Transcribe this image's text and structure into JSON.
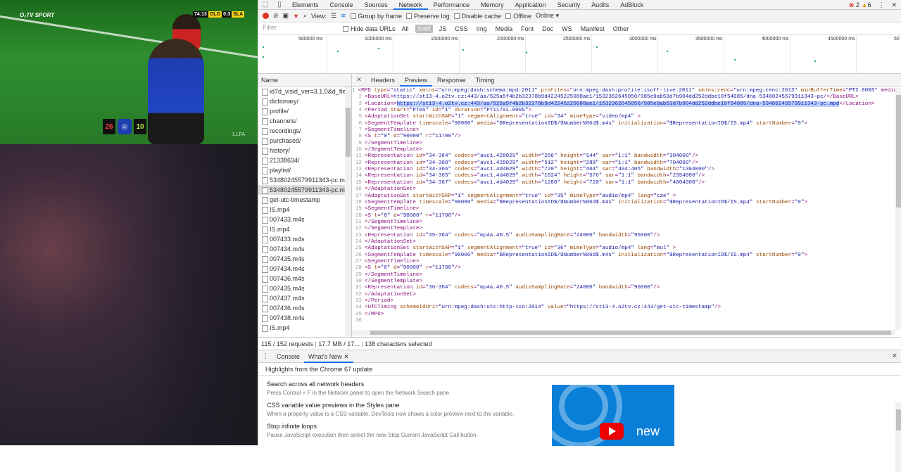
{
  "video": {
    "logo": "O₂TV SPORT",
    "score": {
      "time": "74:13",
      "home": "OLO",
      "result": "0:3",
      "away": "SLA"
    },
    "badge_left": "26",
    "badge_right": "10",
    "watermark": "1.LFA"
  },
  "devtools": {
    "tabs": [
      "Elements",
      "Console",
      "Sources",
      "Network",
      "Performance",
      "Memory",
      "Application",
      "Security",
      "Audits",
      "AdBlock"
    ],
    "errors": "2",
    "warnings": "6",
    "toolbar": {
      "view_label": "View:",
      "group_by_frame": "Group by frame",
      "preserve_log": "Preserve log",
      "disable_cache": "Disable cache",
      "offline": "Offline",
      "throttle": "Online"
    },
    "filter": {
      "placeholder": "Filter",
      "hide_data_urls": "Hide data URLs",
      "types": [
        "All",
        "XHR",
        "JS",
        "CSS",
        "Img",
        "Media",
        "Font",
        "Doc",
        "WS",
        "Manifest",
        "Other"
      ]
    },
    "overview_ticks": [
      "500000 ms",
      "1000000 ms",
      "1500000 ms",
      "2000000 ms",
      "2500000 ms",
      "3000000 ms",
      "3500000 ms",
      "4000000 ms",
      "4500000 ms",
      "50"
    ],
    "name_header": "Name",
    "requests": [
      "id7d_visid_ver=3.1.0&d_fieldgr",
      "dictionary/",
      "profile/",
      "channels/",
      "recordings/",
      "purchased/",
      "history/",
      "21338634/",
      "playlist/",
      "53480245579911343-pc.mpd",
      "53480245579911343-pc.mpd",
      "get-utc-timestamp",
      "IS.mp4",
      "007433.m4s",
      "IS.mp4",
      "007433.m4s",
      "007434.m4s",
      "007435.m4s",
      "007434.m4s",
      "007436.m4s",
      "007435.m4s",
      "007437.m4s",
      "007436.m4s",
      "007438.m4s",
      "IS.mp4"
    ],
    "status": {
      "requests": "115 / 152 requests",
      "transferred": "17.7 MB / 17...",
      "selection": "138 characters selected"
    },
    "detail_tabs": [
      "Headers",
      "Preview",
      "Response",
      "Timing"
    ],
    "code_lines": [
      "<MPD type=\"static\" xmlns=\"urn:mpeg:dash:schema:mpd:2011\" profiles=\"urn:mpeg:dash:profile:isoff-live:2011\" xmlns:cenc=\"urn:mpeg:cenc:2013\" minBufferTime=\"PT2.000S\" mediaP",
      "<BaseURL>https://st13-4.o2tv.cz:443/aa/525a5f4b2b32378b9d42245225088ae1/1532362645050/985e9ab53d7b904dd252ddbe10f54085/dna-53480245579911343-pc/</BaseURL>",
      "<Location>https://st13-4.o2tv.cz:443/aa/525a5f4b2b32378b9d42245225088ae1/1532362645050/985e9ab53d7b904dd252ddbe10f54085/dna-53480245579911343-pc.mpd</Location>",
      "<Period start=\"PT0S\" id=\"1\" duration=\"PT11701.000S\">",
      "<AdaptationSet startWithSAP=\"1\" segmentAlignment=\"true\" id=\"34\" mimeType=\"video/mp4\" >",
      "<SegmentTemplate timescale=\"90000\" media=\"$RepresentationID$/$Number%06d$.m4s\" initialization=\"$RepresentationID$/IS.mp4\" startNumber=\"0\">",
      "<SegmentTimeline>",
      "<S t=\"0\" d=\"90000\" r=\"11700\"/>",
      "</SegmentTimeline>",
      "</SegmentTemplate>",
      "<Representation id=\"34-364\" codecs=\"avc1.428029\" width=\"256\" height=\"144\" sar=\"1:1\" bandwidth=\"304000\"/>",
      "<Representation id=\"34-360\" codecs=\"avc1.428029\" width=\"512\" height=\"288\" sar=\"1:1\" bandwidth=\"704000\"/>",
      "<Representation id=\"34-366\" codecs=\"avc1.4d4029\" width=\"720\" height=\"404\" sar=\"404:405\" bandwidth=\"1304000\"/>",
      "<Representation id=\"34-365\" codecs=\"avc1.4d4029\" width=\"1024\" height=\"576\" sar=\"1:1\" bandwidth=\"2354000\"/>",
      "<Representation id=\"34-367\" codecs=\"avc1.4d4029\" width=\"1280\" height=\"720\" sar=\"1:1\" bandwidth=\"4004000\"/>",
      "</AdaptationSet>",
      "<AdaptationSet startWithSAP=\"1\" segmentAlignment=\"true\" id=\"35\" mimeType=\"audio/mp4\" lang=\"cze\" >",
      "<SegmentTemplate timescale=\"90000\" media=\"$RepresentationID$/$Number%06d$.m4s\" initialization=\"$RepresentationID$/IS.mp4\" startNumber=\"0\">",
      "<SegmentTimeline>",
      "<S t=\"0\" d=\"90000\" r=\"11700\"/>",
      "</SegmentTimeline>",
      "</SegmentTemplate>",
      "<Representation id=\"35-364\" codecs=\"mp4a.40.5\" audioSamplingRate=\"24000\" bandwidth=\"96000\"/>",
      "</AdaptationSet>",
      "<AdaptationSet startWithSAP=\"1\" segmentAlignment=\"true\" id=\"36\" mimeType=\"audio/mp4\" lang=\"mul\" >",
      "<SegmentTemplate timescale=\"90000\" media=\"$RepresentationID$/$Number%06d$.m4s\" initialization=\"$RepresentationID$/IS.mp4\" startNumber=\"0\">",
      "<SegmentTimeline>",
      "<S t=\"0\" d=\"90000\" r=\"11700\"/>",
      "</SegmentTimeline>",
      "</SegmentTemplate>",
      "<Representation id=\"36-364\" codecs=\"mp4a.40.5\" audioSamplingRate=\"24000\" bandwidth=\"96000\"/>",
      "</AdaptationSet>",
      "</Period>",
      "<UTCTiming schemeIdUri=\"urn:mpeg:dash:utc:http-iso:2014\" value=\"https://st13-4.o2tv.cz:443/get-utc-timestamp\"/>",
      "</MPD>",
      ""
    ],
    "drawer": {
      "tabs": [
        "Console",
        "What's New"
      ],
      "highlights": "Highlights from the Chrome 67 update",
      "items": [
        {
          "title": "Search across all network headers",
          "desc": "Press Control + F in the Network panel to open the Network Search pane."
        },
        {
          "title": "CSS variable value previews in the Styles pane",
          "desc": "When a property value is a CSS variable, DevTools now shows a color preview next to the variable."
        },
        {
          "title": "Stop infinite loops",
          "desc": "Pause JavaScript execution then select the new Stop Current JavaScript Call button."
        }
      ],
      "promo_text": "new"
    }
  }
}
